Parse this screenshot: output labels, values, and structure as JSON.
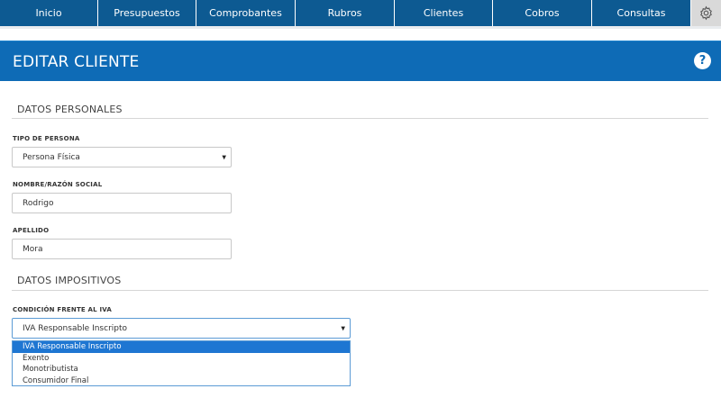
{
  "nav": {
    "items": [
      {
        "label": "Inicio"
      },
      {
        "label": "Presupuestos"
      },
      {
        "label": "Comprobantes"
      },
      {
        "label": "Rubros"
      },
      {
        "label": "Clientes"
      },
      {
        "label": "Cobros"
      },
      {
        "label": "Consultas"
      }
    ],
    "settings_icon": "gear-icon"
  },
  "header": {
    "title": "EDITAR CLIENTE",
    "help_label": "?"
  },
  "sections": {
    "personal": {
      "title": "DATOS PERSONALES"
    },
    "tax": {
      "title": "DATOS IMPOSITIVOS"
    }
  },
  "form": {
    "tipo_persona": {
      "label": "TIPO DE PERSONA",
      "value": "Persona Física"
    },
    "nombre": {
      "label": "NOMBRE/RAZÓN SOCIAL",
      "value": "Rodrigo"
    },
    "apellido": {
      "label": "APELLIDO",
      "value": "Mora"
    },
    "condicion_iva": {
      "label": "CONDICIÓN FRENTE AL IVA",
      "value": "IVA Responsable Inscripto",
      "options": [
        "IVA Responsable Inscripto",
        "Exento",
        "Monotributista",
        "Consumidor Final"
      ],
      "selected_index": 0
    }
  },
  "colors": {
    "nav_bg": "#0d5a92",
    "title_bg": "#0e6bb6",
    "option_highlight": "#1e76d2"
  }
}
